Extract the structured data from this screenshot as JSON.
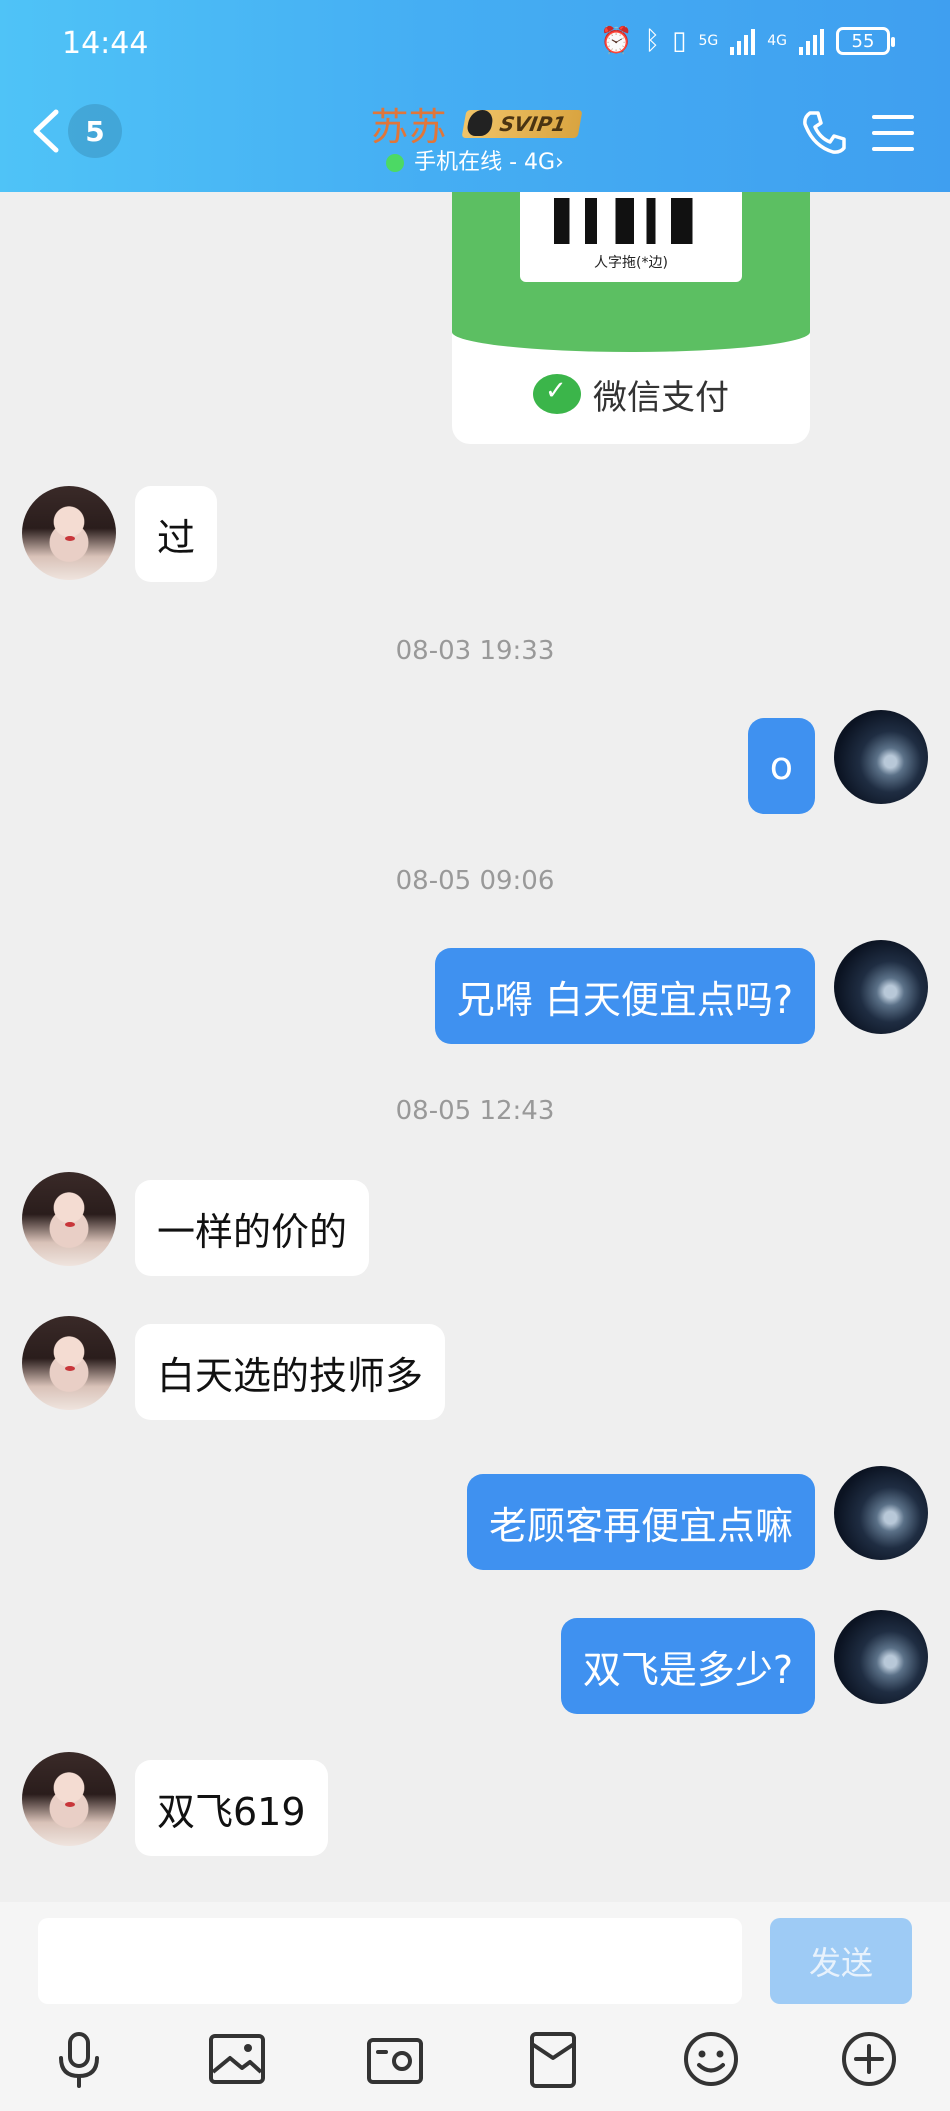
{
  "status_bar": {
    "time": "14:44",
    "network_a": "5G",
    "network_b": "4G",
    "battery": "55"
  },
  "header": {
    "unread_count": "5",
    "contact_name": "苏苏",
    "vip_badge": "SVIP1",
    "presence": "手机在线 - 4G",
    "presence_chevron": "›"
  },
  "payment_card": {
    "qr_caption": "人字拖(*边)",
    "pay_label": "微信支付"
  },
  "messages": [
    {
      "side": "in",
      "text": "过"
    },
    {
      "timestamp": "08-03 19:33"
    },
    {
      "side": "out",
      "text": "o"
    },
    {
      "timestamp": "08-05 09:06"
    },
    {
      "side": "out",
      "text": "兄嘚 白天便宜点吗?"
    },
    {
      "timestamp": "08-05 12:43"
    },
    {
      "side": "in",
      "text": "一样的价的"
    },
    {
      "side": "in",
      "text": "白天选的技师多"
    },
    {
      "side": "out",
      "text": "老顾客再便宜点嘛"
    },
    {
      "side": "out",
      "text": "双飞是多少?"
    },
    {
      "side": "in",
      "text": "双飞619"
    }
  ],
  "composer": {
    "input_value": "",
    "send_label": "发送"
  },
  "toolbar_icons": [
    "microphone-icon",
    "image-icon",
    "camera-icon",
    "red-packet-icon",
    "emoji-icon",
    "plus-icon"
  ],
  "colors": {
    "header_gradient_start": "#4fc3f7",
    "header_gradient_end": "#3f9ff0",
    "outgoing_bubble": "#3f91f0",
    "incoming_bubble": "#ffffff",
    "contact_name": "#e0763a",
    "send_button_disabled": "#9ecbf5",
    "online_dot": "#4cd964"
  }
}
